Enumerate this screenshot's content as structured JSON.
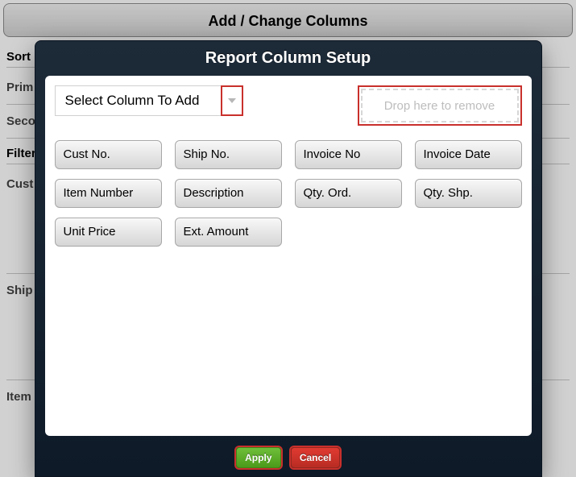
{
  "bg": {
    "header_button": "Add / Change Columns",
    "sort_title": "Sort",
    "labels": {
      "prim": "Prim",
      "seco": "Seco",
      "filter": "Filter",
      "cust": "Cust",
      "ship": "Ship",
      "item": "Item"
    }
  },
  "modal": {
    "title": "Report Column Setup",
    "select_label": "Select Column To Add",
    "dropzone_text": "Drop here to remove",
    "chips": [
      "Cust No.",
      "Ship No.",
      "Invoice No",
      "Invoice Date",
      "Item Number",
      "Description",
      "Qty. Ord.",
      "Qty. Shp.",
      "Unit Price",
      "Ext. Amount"
    ],
    "buttons": {
      "apply": "Apply",
      "cancel": "Cancel"
    }
  }
}
